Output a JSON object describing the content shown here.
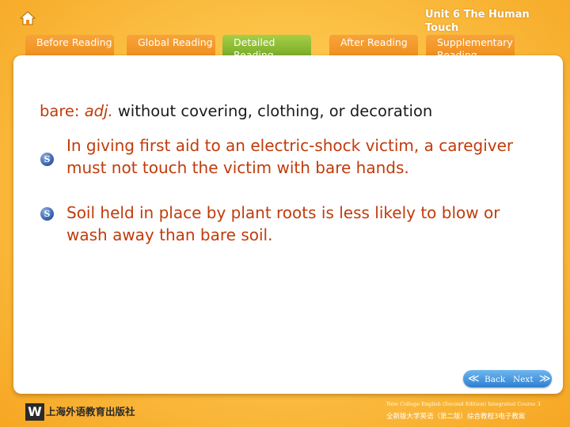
{
  "header": {
    "unit_title": "Unit 6 The Human Touch",
    "tabs": [
      {
        "label": "Before Reading",
        "active": false
      },
      {
        "label": "Global Reading",
        "active": false
      },
      {
        "label": "Detailed Reading",
        "active": true
      },
      {
        "label": "After Reading",
        "active": false
      },
      {
        "label": "Supplementary Reading",
        "active": false
      }
    ]
  },
  "main": {
    "word": "bare",
    "colon": ":",
    "part_of_speech": "adj.",
    "definition": "without covering, clothing, or decoration",
    "sentences": [
      {
        "icon": "S",
        "text": "In giving first aid to an electric-shock victim, a caregiver must not touch the victim with bare hands."
      },
      {
        "icon": "S",
        "text": "Soil held in place by plant roots is less likely to blow or wash away than bare soil."
      }
    ]
  },
  "nav": {
    "back_label": "Back",
    "next_label": "Next",
    "back_arrow": "≪",
    "next_arrow": "≫"
  },
  "footer": {
    "logo_letter": "W",
    "publisher": "上海外语教育出版社",
    "course_en": "New College English (Second Edition) Integrated Course 3",
    "course_cn": "全新版大学英语（第二版）综合教程3电子教案"
  },
  "colors": {
    "accent_red": "#c13b0b",
    "tab_orange": "#f08a18",
    "tab_active_green": "#6ea322",
    "nav_blue": "#2f7fd0",
    "background_orange": "#f6a623"
  },
  "icons": {
    "home": "home-icon",
    "sentence_marker": "sentence-s-icon"
  }
}
